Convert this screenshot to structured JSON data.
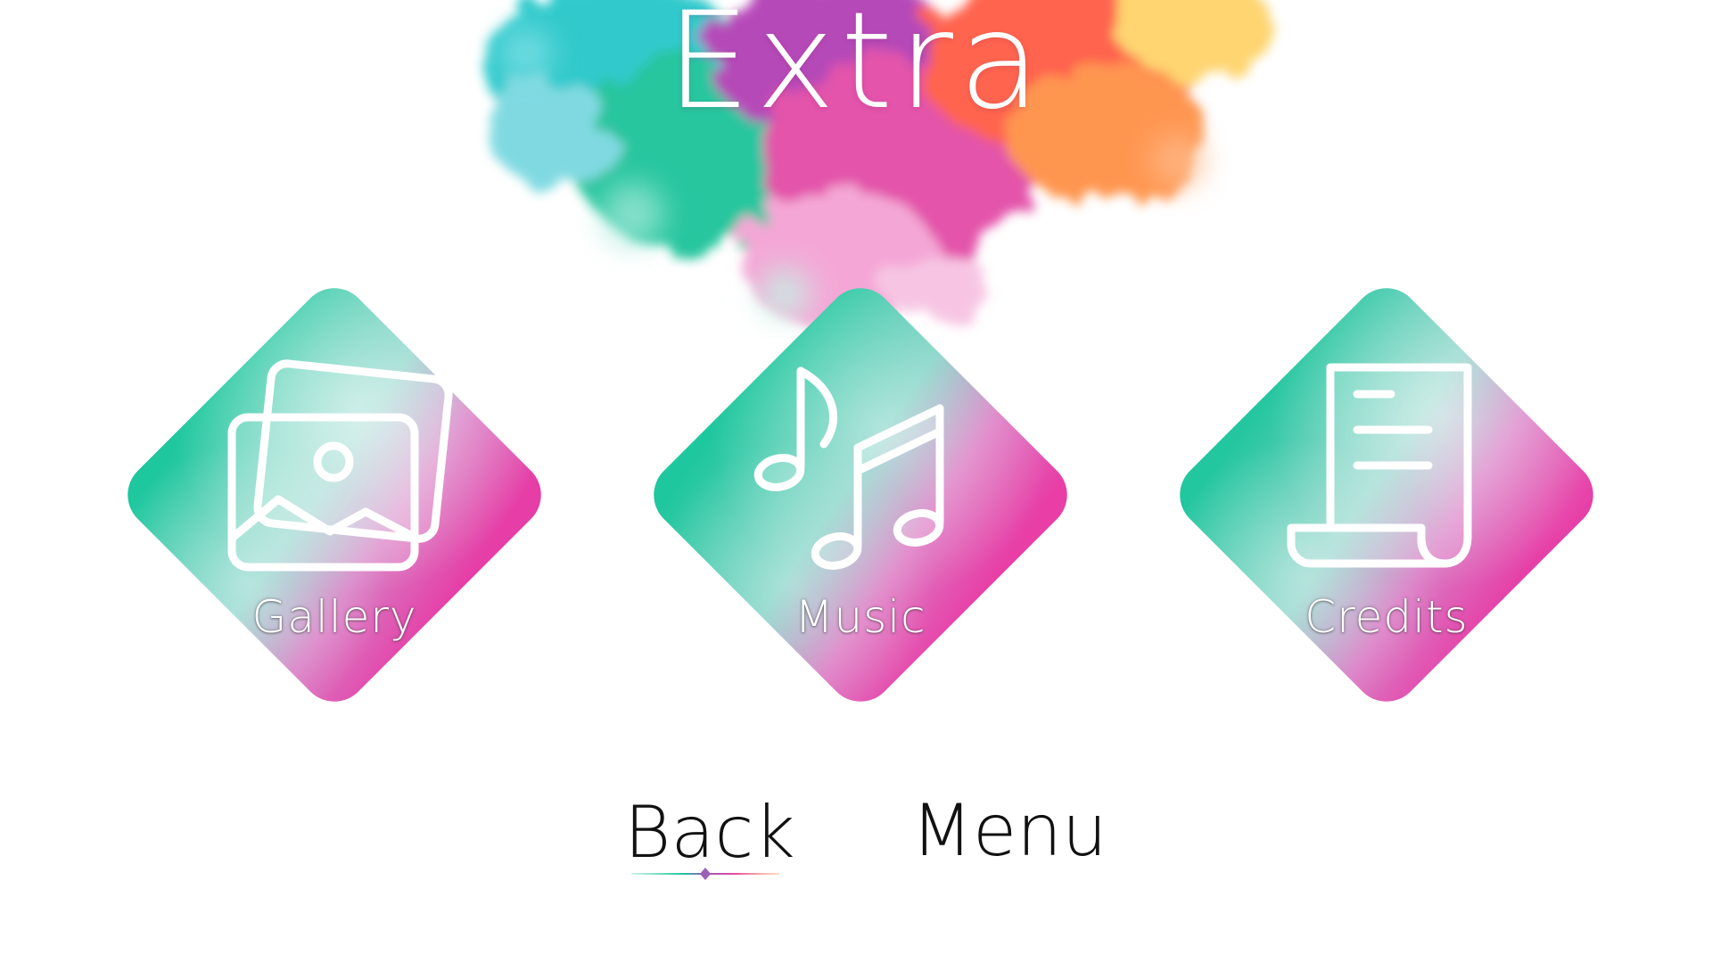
{
  "screen": {
    "title": "Extra"
  },
  "tiles": [
    {
      "id": "gallery",
      "label": "Gallery",
      "icon": "gallery-icon"
    },
    {
      "id": "music",
      "label": "Music",
      "icon": "music-notes-icon"
    },
    {
      "id": "credits",
      "label": "Credits",
      "icon": "scroll-document-icon"
    }
  ],
  "nav": {
    "back_label": "Back",
    "menu_label": "Menu",
    "selected": "back"
  },
  "colors": {
    "teal": "#1fc9a0",
    "magenta": "#e040a8",
    "orange": "#ff7a2a",
    "pink": "#f6a6d8",
    "background": "#ffffff",
    "text_dark": "#111111"
  }
}
